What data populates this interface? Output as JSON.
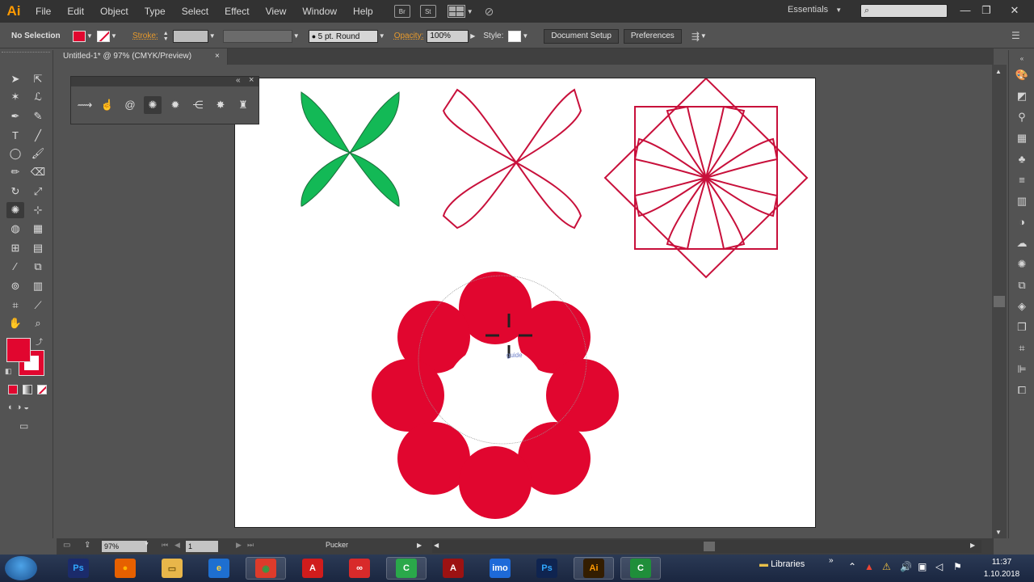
{
  "app": {
    "logo": "Ai",
    "menu": [
      "File",
      "Edit",
      "Object",
      "Type",
      "Select",
      "Effect",
      "View",
      "Window",
      "Help"
    ],
    "bridge_label": "Br",
    "stock_label": "St",
    "workspace": "Essentials",
    "window_controls": [
      "minimize-icon",
      "restore-icon",
      "close-icon"
    ]
  },
  "control_bar": {
    "selection": "No Selection",
    "fill_color": "#e1062f",
    "stroke_label": "Stroke:",
    "stroke_profile": "5 pt. Round",
    "opacity_label": "Opacity:",
    "opacity_value": "100%",
    "style_label": "Style:",
    "document_setup": "Document Setup",
    "preferences": "Preferences"
  },
  "document": {
    "tab_title": "Untitled-1* @ 97% (CMYK/Preview)",
    "tab_close": "×"
  },
  "tools": {
    "fill_color": "#e1062f",
    "stroke_color": "#e1062f"
  },
  "float_panel": {
    "close": "×",
    "collapse": "«"
  },
  "canvas": {
    "green_color": "#13b956",
    "red_color": "#e1062f",
    "outline_color": "#c8103b",
    "guide_hint": "guide"
  },
  "status_bar": {
    "zoom": "97%",
    "page": "1",
    "tool_name": "Pucker"
  },
  "taskbar": {
    "apps": [
      {
        "name": "photoshop",
        "label": "Ps",
        "color": "#1b2b6b",
        "fg": "#31a8ff"
      },
      {
        "name": "firefox",
        "label": "●",
        "color": "#e66000",
        "fg": "#ffb400"
      },
      {
        "name": "explorer",
        "label": "▭",
        "color": "#e8b64a",
        "fg": "#7a5a10"
      },
      {
        "name": "internet-explorer",
        "label": "e",
        "color": "#1e6fd0",
        "fg": "#ffd23c"
      },
      {
        "name": "chrome",
        "label": "◉",
        "color": "#dd3b2b",
        "fg": "#2c9e47"
      },
      {
        "name": "acrobat",
        "label": "A",
        "color": "#d01c1c",
        "fg": "#ffffff"
      },
      {
        "name": "creative-cloud",
        "label": "∞",
        "color": "#d82a2a",
        "fg": "#ffffff"
      },
      {
        "name": "camtasia-1",
        "label": "C",
        "color": "#2aa84a",
        "fg": "#ffffff"
      },
      {
        "name": "acrobat-2",
        "label": "A",
        "color": "#9c1212",
        "fg": "#ffffff"
      },
      {
        "name": "imo",
        "label": "imo",
        "color": "#1e6ad8",
        "fg": "#ffffff"
      },
      {
        "name": "photoshop-2",
        "label": "Ps",
        "color": "#0f2450",
        "fg": "#31a8ff"
      },
      {
        "name": "illustrator",
        "label": "Ai",
        "color": "#331d00",
        "fg": "#ff9a00"
      },
      {
        "name": "camtasia-2",
        "label": "C",
        "color": "#1f8e3a",
        "fg": "#ffffff"
      }
    ],
    "libraries": "Libraries",
    "time": "11:37",
    "date": "1.10.2018"
  }
}
